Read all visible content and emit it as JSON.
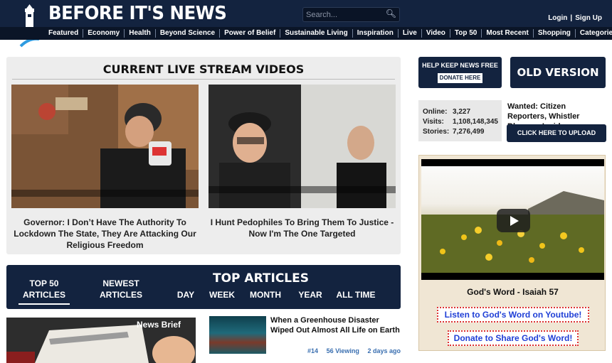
{
  "header": {
    "brand": "BEFORE IT'S NEWS",
    "search_placeholder": "Search...",
    "login": "Login",
    "signup": "Sign Up",
    "nav": [
      "Featured",
      "Economy",
      "Health",
      "Beyond Science",
      "Power of Belief",
      "Sustainable Living",
      "Inspiration",
      "Live",
      "Video",
      "Top 50",
      "Most Recent",
      "Shopping",
      "Categories"
    ]
  },
  "live": {
    "title": "CURRENT LIVE STREAM VIDEOS",
    "videos": [
      {
        "caption": "Governor: I Don’t Have The Authority To Lockdown The State, They Are Attacking Our Religious Freedom"
      },
      {
        "caption": "I Hunt Pedophiles To Bring Them To Justice - Now I'm The One Targeted"
      }
    ]
  },
  "top": {
    "title": "TOP ARTICLES",
    "tab_top50": "TOP 50 ARTICLES",
    "tab_newest": "NEWEST ARTICLES",
    "periods": [
      "DAY",
      "WEEK",
      "MONTH",
      "YEAR",
      "ALL TIME"
    ]
  },
  "newsbrief": {
    "label": "News Brief"
  },
  "article": {
    "title": "When a Greenhouse Disaster Wiped Out Almost All Life on Earth",
    "rank": "#14",
    "viewing": "56 Viewing",
    "time": "2 days ago"
  },
  "right": {
    "help": "HELP KEEP NEWS FREE",
    "donate": "DONATE HERE",
    "old": "OLD VERSION",
    "stats": [
      {
        "k": "Online:",
        "v": "3,227"
      },
      {
        "k": "Visits:",
        "v": "1,108,148,345"
      },
      {
        "k": "Stories:",
        "v": "7,276,499"
      }
    ],
    "wanted": "Wanted: Citizen Reporters, Whistler Blowers, Insiders",
    "upload": "CLICK HERE TO UPLOAD NEWS!",
    "gods_title": "God's Word - Isaiah 57",
    "gods_link1": "Listen to God's Word on Youtube!",
    "gods_link2": "Donate to Share God's Word!"
  },
  "colors": {
    "navy": "#13233f",
    "link_blue": "#1f3fd6",
    "meta_blue": "#3a6fb0"
  }
}
